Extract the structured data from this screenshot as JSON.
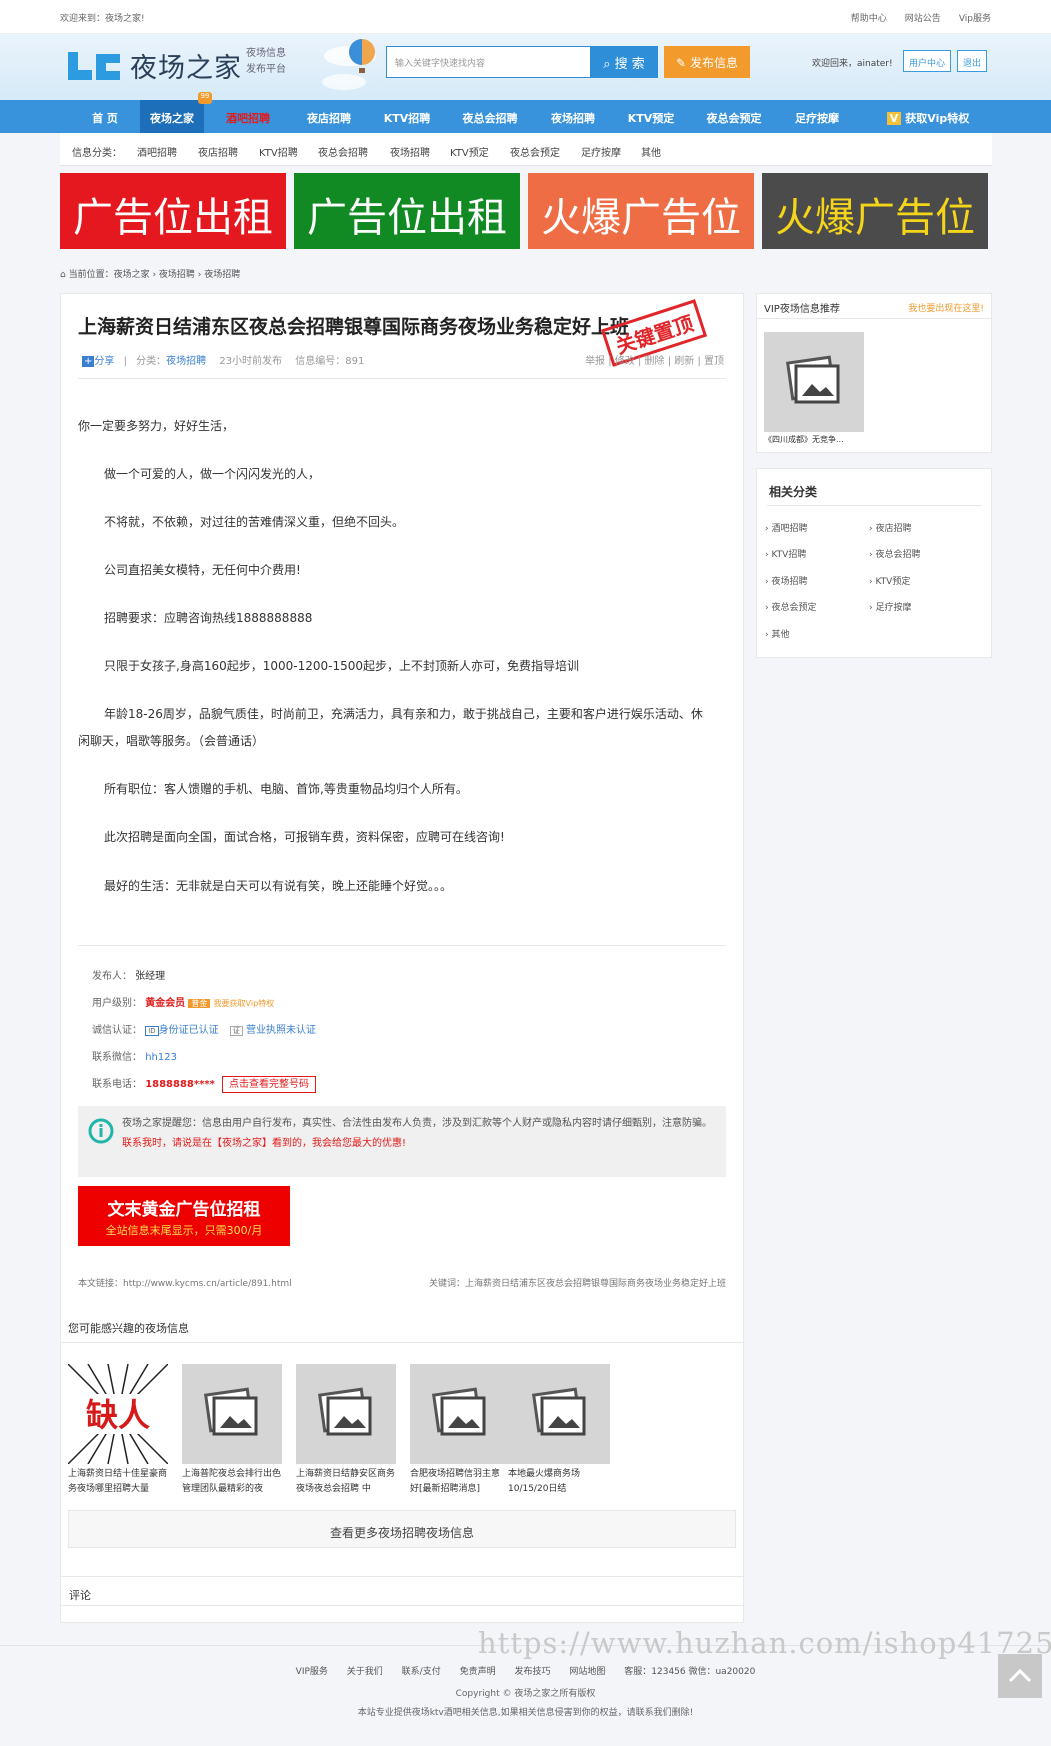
{
  "topbar": {
    "welcome": "欢迎来到：夜场之家!",
    "links": [
      "帮助中心",
      "网站公告",
      "Vip服务"
    ]
  },
  "header": {
    "logo_text": "夜场之家",
    "logo_sub1": "夜场信息",
    "logo_sub2": "发布平台",
    "search_placeholder": "输入关键字快速找内容",
    "search_btn": "搜 索",
    "post_btn": "发布信息",
    "welcome_user": "欢迎回来，ainater!",
    "user_center": "用户中心",
    "logout": "退出"
  },
  "nav": {
    "items": [
      "首 页",
      "夜场之家",
      "酒吧招聘",
      "夜店招聘",
      "KTV招聘",
      "夜总会招聘",
      "夜场招聘",
      "KTV预定",
      "夜总会预定",
      "足疗按摩",
      "获取Vip特权"
    ],
    "badge": "99"
  },
  "subnav": {
    "label": "信息分类：",
    "items": [
      "酒吧招聘",
      "夜店招聘",
      "KTV招聘",
      "夜总会招聘",
      "夜场招聘",
      "KTV预定",
      "夜总会预定",
      "足疗按摩",
      "其他"
    ]
  },
  "ads": [
    {
      "text": "广告位出租",
      "color": "#e5171f"
    },
    {
      "text": "广告位出租",
      "color": "#118a23"
    },
    {
      "text": "火爆广告位",
      "color": "#ee6d45"
    },
    {
      "text": "火爆广告位",
      "color": "#4b4b4b"
    }
  ],
  "breadcrumb": "当前位置：夜场之家 › 夜场招聘 › 夜场招聘",
  "article": {
    "title": "上海薪资日结浦东区夜总会招聘银尊国际商务夜场业务稳定好上班",
    "stamp": "关键置顶",
    "share": "分享",
    "category_label": "分类：",
    "category": "夜场招聘",
    "time": "23小时前发布",
    "info_no": "信息编号：891",
    "actions": [
      "举报",
      "修改",
      "删除",
      "刷新",
      "置顶"
    ],
    "paragraphs": [
      "你一定要多努力，好好生活，",
      "做一个可爱的人，做一个闪闪发光的人，",
      "不将就，不依赖，对过往的苦难倩深义重，但绝不回头。",
      "公司直招美女模特，无任何中介费用!",
      "招聘要求：应聘咨询热线1888888888",
      "只限于女孩子,身高160起步，1000-1200-1500起步，上不封顶新人亦可，免费指导培训",
      "年龄18-26周岁，品貌气质佳，时尚前卫，充满活力，具有亲和力，敢于挑战自己，主要和客户进行娱乐活动、休",
      "闲聊天，唱歌等服务。（会普通话）",
      "所有职位：客人馈赠的手机、电脑、首饰,等贵重物品均归个人所有。",
      "此次招聘是面向全国，面试合格，可报销车费，资料保密，应聘可在线咨询!",
      "最好的生活：无非就是白天可以有说有笑，晚上还能睡个好觉。。。"
    ],
    "poster_label": "发布人：",
    "poster": "张经理",
    "level_label": "用户级别：",
    "level": "黄金会员",
    "level_badge": "普金",
    "level_link": "我要获取Vip特权",
    "cert_label": "诚信认证：",
    "cert_id": "身份证已认证",
    "cert_biz": "营业执照未认证",
    "wechat_label": "联系微信：",
    "wechat": "hh123",
    "phone_label": "联系电话：",
    "phone": "1888888****",
    "phone_btn": "点击查看完整号码",
    "notice": "夜场之家提醒您：信息由用户自行发布，真实性、合法性由发布人负责，涉及到汇款等个人财产或隐私内容时请仔细甄别，注意防骗。",
    "notice_red": "联系我时，请说是在【夜场之家】看到的，我会给您最大的优惠!",
    "ad2_line1": "文末黄金广告位招租",
    "ad2_line2": "全站信息末尾显示，只需300/月",
    "link": "本文链接：http://www.kycms.cn/article/891.html",
    "keywords": "关键词：上海薪资日结浦东区夜总会招聘银尊国际商务夜场业务稳定好上班"
  },
  "related": {
    "title": "您可能感兴趣的夜场信息",
    "items": [
      {
        "caption": "上海薪资日结十佳星豪商务夜场哪里招聘大量",
        "img": "缺人"
      },
      {
        "caption": "上海普陀夜总会排行出色管理团队最精彩的夜"
      },
      {
        "caption": "上海薪资日结静安区商务夜场夜总会招聘 中"
      },
      {
        "caption": "合肥夜场招聘信羽主意好[最新招聘消息]"
      },
      {
        "caption": "本地最火爆商务场10/15/20日结"
      }
    ],
    "more": "查看更多夜场招聘夜场信息"
  },
  "comment": "评论",
  "sidebar": {
    "vip_title": "VIP夜场信息推荐",
    "vip_link": "我也要出现在这里!",
    "vip_caption": "《四川成都》无竞争...",
    "cat_title": "相关分类",
    "cats": [
      "酒吧招聘",
      "夜店招聘",
      "KTV招聘",
      "夜总会招聘",
      "夜场招聘",
      "KTV预定",
      "夜总会预定",
      "足疗按摩",
      "其他"
    ]
  },
  "footer": {
    "links": [
      "VIP服务",
      "关于我们",
      "联系/支付",
      "免责声明",
      "发布技巧",
      "网站地图",
      "客服：123456 微信：ua20020"
    ],
    "copyright": "Copyright © 夜场之家之所有版权",
    "disclaimer": "本站专业提供夜场ktv酒吧相关信息,如果相关信息侵害到你的权益，请联系我们删除!"
  },
  "watermark": "https://www.huzhan.com/ishop41725"
}
